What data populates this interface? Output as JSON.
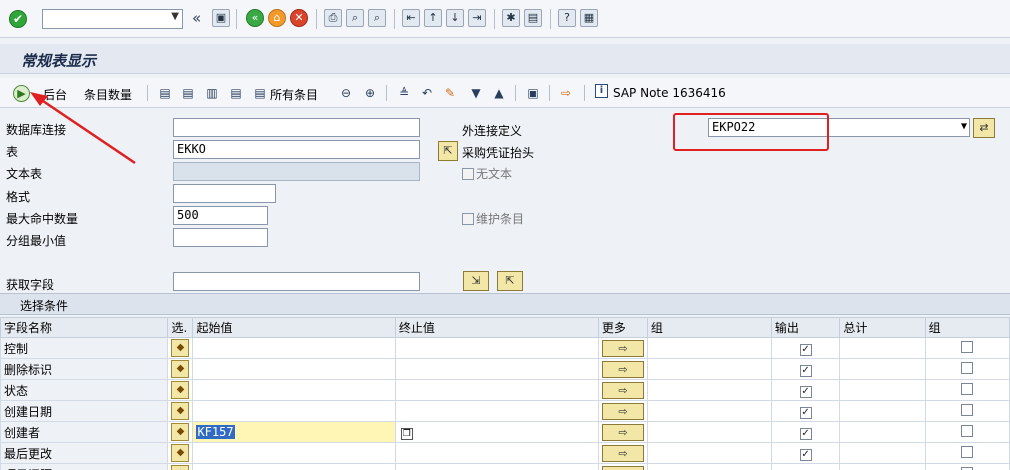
{
  "toolbar": {
    "command_value": "",
    "icons": [
      "ok-icon",
      "back-nav-icon",
      "save-icon",
      "back-icon",
      "exit-icon",
      "cancel-icon",
      "print-icon",
      "find-icon",
      "find-next-icon",
      "first-page-icon",
      "prev-page-icon",
      "next-page-icon",
      "last-page-icon",
      "new-session-icon",
      "shortcut-icon",
      "help-icon",
      "customize-icon"
    ]
  },
  "title": "常规表显示",
  "app_toolbar": {
    "background_label": "后台",
    "entry_count_label": "条目数量",
    "all_entries_label": "所有条目",
    "sap_note_label": "SAP Note 1636416"
  },
  "form": {
    "db_connection_label": "数据库连接",
    "db_connection_value": "",
    "table_label": "表",
    "table_value": "EKKO",
    "table_description": "采购凭证抬头",
    "text_table_label": "文本表",
    "text_table_value": "",
    "no_text_label": "无文本",
    "format_label": "格式",
    "format_value": "",
    "max_hits_label": "最大命中数量",
    "max_hits_value": "500",
    "maintain_entries_label": "维护条目",
    "group_min_label": "分组最小值",
    "group_min_value": "",
    "fetch_fields_label": "获取字段",
    "fetch_fields_value": "",
    "outer_join_label": "外连接定义",
    "outer_join_value": "EKPO22"
  },
  "selection": {
    "title": "选择条件",
    "columns": {
      "field_name": "字段名称",
      "sel": "选.",
      "from": "起始值",
      "to": "终止值",
      "more": "更多",
      "group": "组",
      "output": "输出",
      "total": "总计",
      "group2": "组"
    },
    "rows": [
      {
        "name": "控制",
        "from": "",
        "output": true
      },
      {
        "name": "删除标识",
        "from": "",
        "output": true
      },
      {
        "name": "状态",
        "from": "",
        "output": true
      },
      {
        "name": "创建日期",
        "from": "",
        "output": true
      },
      {
        "name": "创建者",
        "from": "KF157",
        "output": true
      },
      {
        "name": "最后更改",
        "from": "",
        "output": true
      },
      {
        "name": "项目间隔",
        "from": "",
        "output": true
      }
    ]
  },
  "colors": {
    "highlight_red": "#e02020",
    "title_bg": "#e4e9f1",
    "active_cell": "#fff5b5"
  }
}
